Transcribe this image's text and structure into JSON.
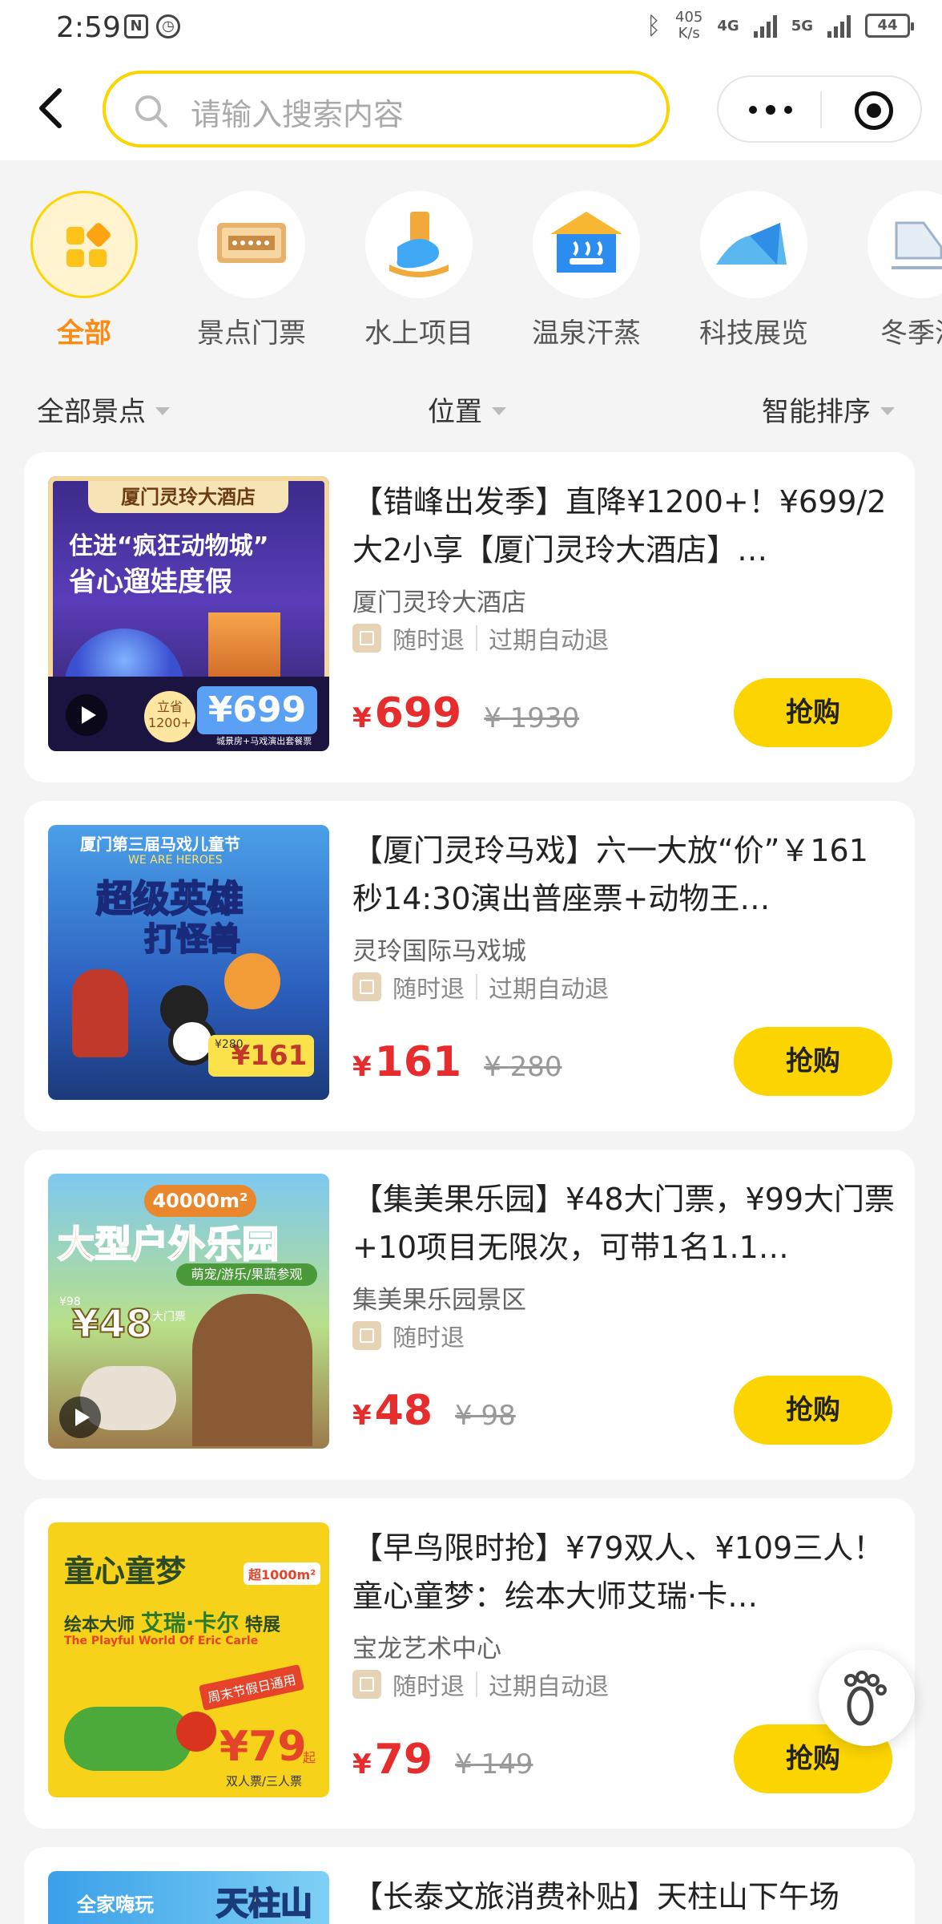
{
  "status_bar": {
    "time": "2:59",
    "speed": "405",
    "speed_unit": "K/s",
    "net1": "4G",
    "net2": "5G",
    "battery": "44"
  },
  "search": {
    "placeholder": "请输入搜索内容"
  },
  "categories": [
    {
      "label": "全部",
      "icon": "grid-icon"
    },
    {
      "label": "景点门票",
      "icon": "ticket-icon"
    },
    {
      "label": "水上项目",
      "icon": "water-slide-icon"
    },
    {
      "label": "温泉汗蒸",
      "icon": "hot-spring-icon"
    },
    {
      "label": "科技展览",
      "icon": "exhibition-icon"
    },
    {
      "label": "冬季滑",
      "icon": "skate-icon"
    }
  ],
  "filters": {
    "scenic": "全部景点",
    "location": "位置",
    "sort": "智能排序"
  },
  "products": [
    {
      "title": "【错峰出发季】直降¥1200+！¥699/2大2小享【厦门灵玲大酒店】…",
      "venue": "厦门灵玲大酒店",
      "tags": [
        "随时退",
        "过期自动退"
      ],
      "price": "699",
      "original": "1930",
      "buy": "抢购",
      "thumb": {
        "banner": "厦门灵玲大酒店",
        "line1": "住进“疯狂动物城”",
        "line2": "省心遛娃度假",
        "badge": "立省",
        "badge2": "1200+",
        "price": "¥699",
        "foot": "城景房+马戏演出套餐票"
      }
    },
    {
      "title": "【厦门灵玲马戏】六一大放“价”￥161秒14:30演出普座票+动物王…",
      "venue": "灵玲国际马戏城",
      "tags": [
        "随时退",
        "过期自动退"
      ],
      "price": "161",
      "original": "280",
      "buy": "抢购",
      "thumb": {
        "top": "厦门第三届马戏儿童节",
        "sub": "WE ARE HEROES",
        "line1": "超级英雄",
        "line2": "打怪兽",
        "old": "¥280",
        "price": "¥161"
      }
    },
    {
      "title": "【集美果乐园】¥48大门票，¥99大门票+10项目无限次，可带1名1.1…",
      "venue": "集美果乐园景区",
      "tags": [
        "随时退"
      ],
      "price": "48",
      "original": "98",
      "buy": "抢购",
      "thumb": {
        "area": "40000m²",
        "line1": "大型户外乐园",
        "sub": "萌宠/游乐/果蔬参观",
        "old": "¥98",
        "price": "¥48",
        "ticket": "大门票"
      }
    },
    {
      "title": "【早鸟限时抢】¥79双人、¥109三人！童心童梦：绘本大师艾瑞·卡…",
      "venue": "宝龙艺术中心",
      "tags": [
        "随时退",
        "过期自动退"
      ],
      "price": "79",
      "original": "149",
      "buy": "抢购",
      "thumb": {
        "line1": "童心童梦",
        "badge": "超1000m²",
        "line2a": "绘本大师",
        "line2b": "艾瑞·卡尔",
        "line2c": "特展",
        "en": "The Playful World Of Eric Carle",
        "promo": "周末节假日通用",
        "price": "¥79",
        "qi": "起",
        "foot": "双人票/三人票"
      }
    },
    {
      "title": "【长泰文旅消费补贴】天柱山下午场",
      "thumb": {
        "line1": "全家嗨玩",
        "line2": "天柱山"
      }
    }
  ]
}
